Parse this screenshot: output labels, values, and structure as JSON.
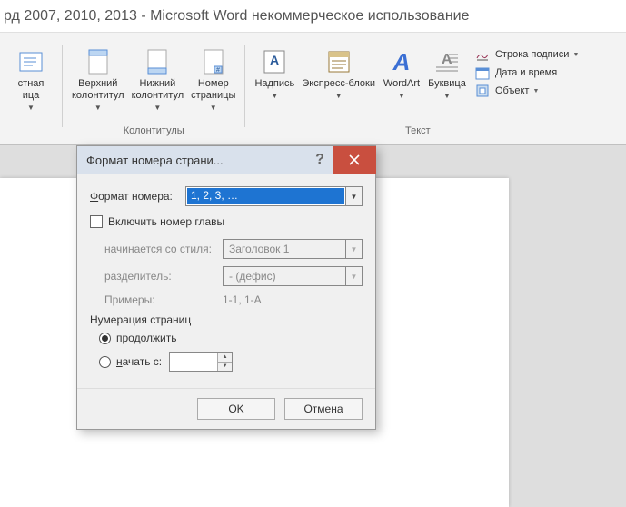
{
  "title": "рд 2007, 2010, 2013  -  Microsoft Word некоммерческое использование",
  "ribbon": {
    "textbox_partial": {
      "line1": "стная",
      "line2": "ица"
    },
    "header": {
      "line1": "Верхний",
      "line2": "колонтитул"
    },
    "footer": {
      "line1": "Нижний",
      "line2": "колонтитул"
    },
    "pagenum": {
      "line1": "Номер",
      "line2": "страницы"
    },
    "group_hf": "Колонтитулы",
    "caption": "Надпись",
    "quick": "Экспресс-блоки",
    "wordart": "WordArt",
    "dropcap": "Буквица",
    "group_text": "Текст",
    "sig": "Строка подписи",
    "datetime": "Дата и время",
    "object": "Объект"
  },
  "dialog": {
    "title": "Формат номера страни...",
    "format_label": "Формат номера:",
    "format_accel": "Ф",
    "format_value": "1, 2, 3, …",
    "include": "Включить номер главы",
    "starts_style": "начинается со стиля:",
    "style_value": "Заголовок 1",
    "separator": "разделитель:",
    "separator_value": "-   (дефис)",
    "examples_label": "Примеры:",
    "examples_value": "1-1, 1-A",
    "numbering": "Нумерация страниц",
    "continue": "продолжить",
    "startat": "начать с:",
    "ok": "OK",
    "cancel": "Отмена"
  }
}
